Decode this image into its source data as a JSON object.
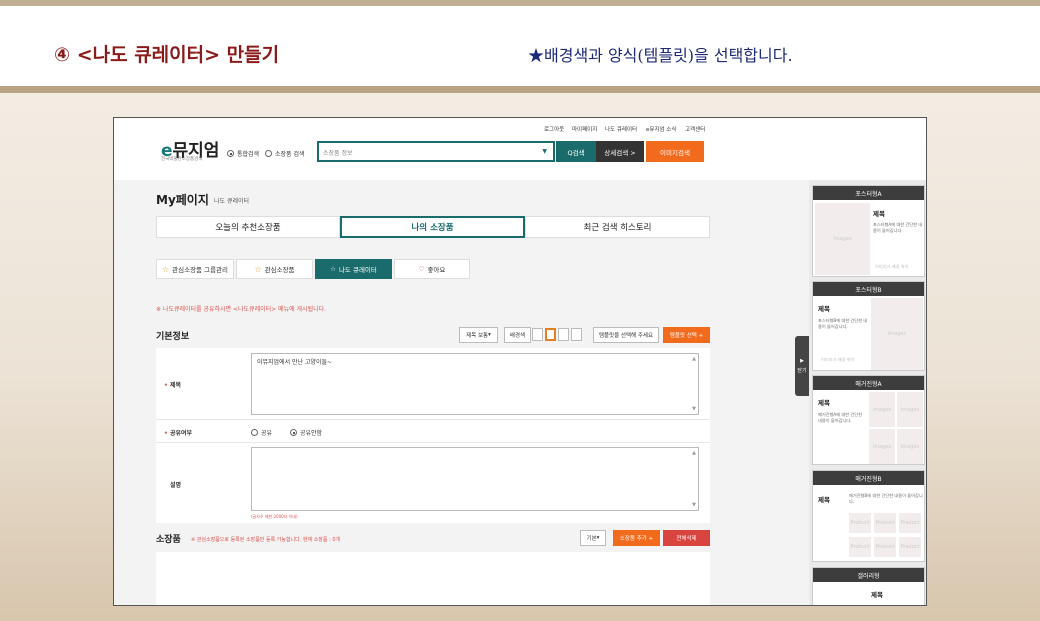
{
  "heading": {
    "title": "④ <나도 큐레이터> 만들기",
    "subtitle": "★배경색과 양식(템플릿)을 선택합니다."
  },
  "toplinks": [
    "로그아웃",
    "마이페이지",
    "나도 큐레이터",
    "e뮤지엄 소식",
    "고객센터"
  ],
  "logo": {
    "brand": "뮤지엄",
    "prefix": "e",
    "sub": "전국박물관소장품검색"
  },
  "search": {
    "opt1": "통합검색",
    "opt2": "소장품 검색",
    "placeholder": "소장품 정보",
    "btn_search": "Q검색",
    "btn_detail": "상세검색 >",
    "btn_image": "이미지검색"
  },
  "mypage": {
    "title": "My페이지",
    "crumb": "나도 큐레이터"
  },
  "tabs": [
    "오늘의 추천소장품",
    "나의 소장품",
    "최근 검색 히스토리"
  ],
  "subtabs": [
    "관심소장품 그룹관리",
    "관심소장품",
    "나도 큐레이터",
    "좋아요"
  ],
  "notice": "※ 나도큐레이터를 공유하시면 <나도큐레이터> 메뉴에 게시됩니다.",
  "basic": {
    "heading": "기본정보",
    "title_opt": "제목 보통",
    "bg_label": "배경색",
    "template_hint": "템플릿을 선택해 주세요",
    "template_btn": "템플릿 선택 +"
  },
  "form": {
    "title_label": "제목",
    "title_value": "이뮤지엄에서 만난 고양이들~",
    "share_label": "공유여부",
    "share_yes": "공유",
    "share_no": "공유안함",
    "desc_label": "설명",
    "desc_hint": "(글자수 제한 2000자 이내)"
  },
  "items": {
    "heading": "소장품",
    "note": "※ 관심소장품으로 등록된 소장품만 등록 가능합니다.   현재 소장품 : 0개",
    "sort": "기본",
    "add": "소장품 추가 +",
    "del": "전체삭제"
  },
  "sidebar": {
    "toggle": "닫기",
    "cards": [
      {
        "name": "포스터형A",
        "title": "제목",
        "desc": "포스터형A에 대한 간단한 내용이 들어갑니다.",
        "ph": "images",
        "foot": "이미지가 배경 위치"
      },
      {
        "name": "포스터형B",
        "title": "제목",
        "desc": "포스터형B에 대한 간단한 내용이 들어갑니다.",
        "ph": "images",
        "foot": "이미지가 배경 위치"
      },
      {
        "name": "매거진형A",
        "title": "제목",
        "desc": "매거진형A에 대한 간단한 내용이 들어갑니다.",
        "ph": "images"
      },
      {
        "name": "매거진형B",
        "title": "제목",
        "desc": "매거진형B에 대한 간단한 내용이 들어갑니다.",
        "ph": "Product"
      },
      {
        "name": "갤러리형",
        "title": "제목"
      }
    ]
  }
}
